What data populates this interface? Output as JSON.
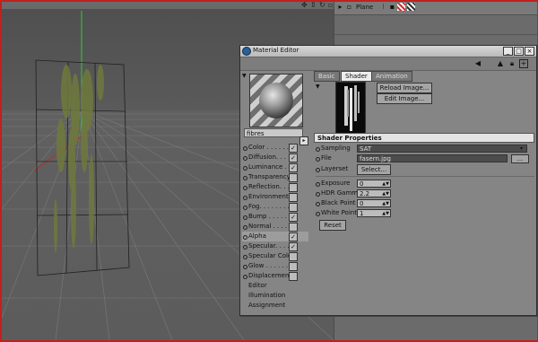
{
  "right_panel": {
    "object_name": "Plane"
  },
  "material_editor": {
    "title": "Material Editor",
    "material_name": "fibres",
    "channels": [
      {
        "label": "Color . . . . . .",
        "checked": true
      },
      {
        "label": "Diffusion. . . . .",
        "checked": true
      },
      {
        "label": "Luminance . . .",
        "checked": true
      },
      {
        "label": "Transparency",
        "checked": false
      },
      {
        "label": "Reflection. . . .",
        "checked": false
      },
      {
        "label": "Environment",
        "checked": false
      },
      {
        "label": "Fog. . . . . . . .",
        "checked": false
      },
      {
        "label": "Bump . . . . . .",
        "checked": true
      },
      {
        "label": "Normal . . . . .",
        "checked": false
      },
      {
        "label": "Alpha",
        "checked": true
      },
      {
        "label": "Specular. . . . .",
        "checked": true
      },
      {
        "label": "Specular Color",
        "checked": false
      },
      {
        "label": "Glow . . . . . .",
        "checked": false
      },
      {
        "label": "Displacement",
        "checked": false
      }
    ],
    "extra_items": [
      "Editor",
      "Illumination",
      "Assignment"
    ],
    "tabs": [
      {
        "label": "Basic",
        "active": false
      },
      {
        "label": "Shader",
        "active": true
      },
      {
        "label": "Animation",
        "active": false
      }
    ],
    "buttons": {
      "reload_image": "Reload Image...",
      "edit_image": "Edit Image...",
      "select": "Select...",
      "reset": "Reset",
      "more": "..."
    },
    "shader_properties": {
      "header": "Shader Properties",
      "sampling": {
        "label": "Sampling",
        "value": "SAT"
      },
      "file": {
        "label": "File",
        "value": "fasern.jpg"
      },
      "layerset": {
        "label": "Layerset"
      },
      "exposure": {
        "label": "Exposure",
        "value": "0"
      },
      "hdr_gamma": {
        "label": "HDR Gamma",
        "value": "2.2"
      },
      "black_point": {
        "label": "Black Point",
        "value": "0"
      },
      "white_point": {
        "label": "White Point",
        "value": "1"
      }
    }
  },
  "icons": {
    "left": "arrow-left-icon",
    "up": "arrow-up-icon",
    "lock": "lock-icon",
    "new_window": "new-window-icon"
  },
  "colors": {
    "frame_border": "#c21f1f",
    "grid_line": "#7a7a7a",
    "y_axis": "#2bd02b",
    "x_axis": "#c02a2a"
  }
}
